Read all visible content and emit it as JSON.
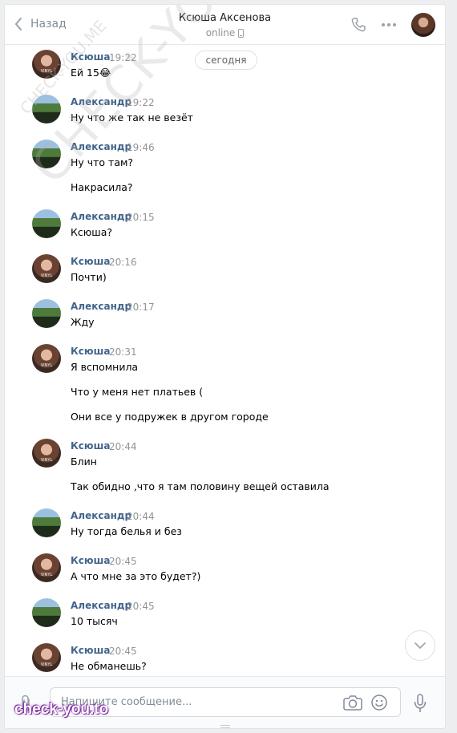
{
  "header": {
    "back_label": "Назад",
    "title": "Ксюша Аксенова",
    "status": "online"
  },
  "chat": {
    "date_label": "сегодня",
    "messages": [
      {
        "name": "Ксюша",
        "time": "19:22",
        "avatar": "k",
        "lines": [
          "Ей 15😂"
        ]
      },
      {
        "name": "Александр",
        "time": "19:22",
        "avatar": "a",
        "lines": [
          "Ну что же так не везёт"
        ]
      },
      {
        "name": "Александр",
        "time": "19:46",
        "avatar": "a",
        "lines": [
          "Ну что там?",
          "Накрасила?"
        ]
      },
      {
        "name": "Александр",
        "time": "20:15",
        "avatar": "a",
        "lines": [
          "Ксюша?"
        ]
      },
      {
        "name": "Ксюша",
        "time": "20:16",
        "avatar": "k",
        "lines": [
          "Почти)"
        ]
      },
      {
        "name": "Александр",
        "time": "20:17",
        "avatar": "a",
        "lines": [
          "Жду"
        ]
      },
      {
        "name": "Ксюша",
        "time": "20:31",
        "avatar": "k",
        "lines": [
          "Я вспомнила",
          "Что у меня нет платьев (",
          "Они все у подружек в другом городе"
        ]
      },
      {
        "name": "Ксюша",
        "time": "20:44",
        "avatar": "k",
        "lines": [
          "Блин",
          "Так обидно ,что я там половину вещей оставила"
        ]
      },
      {
        "name": "Александр",
        "time": "20:44",
        "avatar": "a",
        "lines": [
          "Ну тогда белья и без"
        ]
      },
      {
        "name": "Ксюша",
        "time": "20:45",
        "avatar": "k",
        "lines": [
          "А что мне за это будет?)"
        ]
      },
      {
        "name": "Александр",
        "time": "20:45",
        "avatar": "a",
        "lines": [
          "10 тысяч"
        ]
      },
      {
        "name": "Ксюша",
        "time": "20:45",
        "avatar": "k",
        "lines": [
          "Не обманешь?"
        ]
      }
    ],
    "avatar_caption": "VINYL"
  },
  "composer": {
    "placeholder": "Напишите сообщение..."
  },
  "watermarks": {
    "big": "CHECK-YOU.ME",
    "small": "CHECK-YOU.ME",
    "bottom": "check-you.to"
  }
}
